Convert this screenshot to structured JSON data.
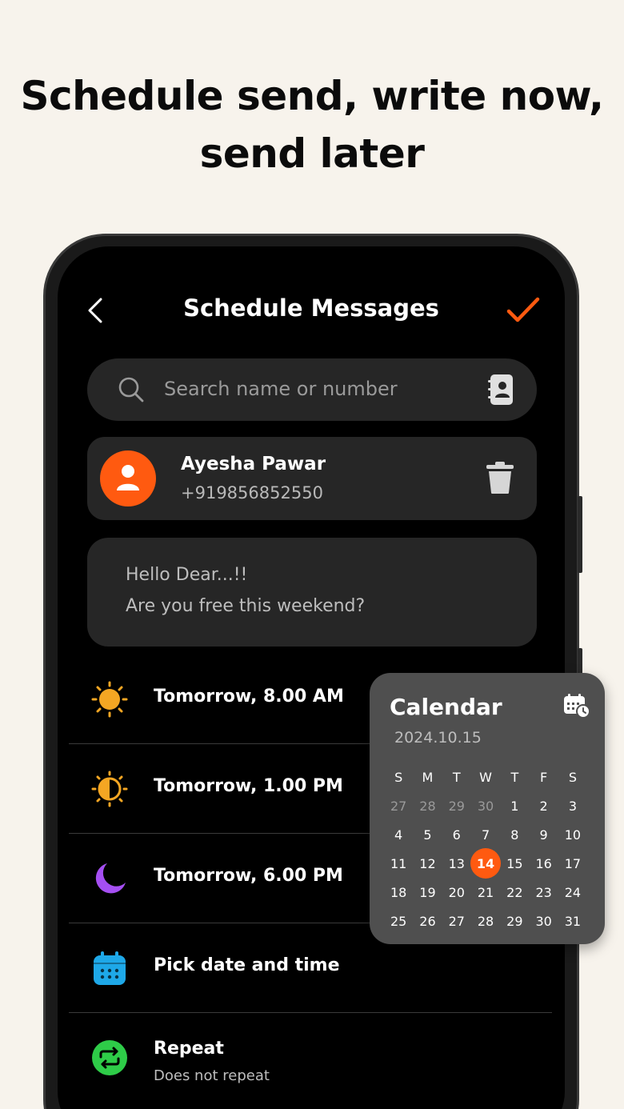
{
  "headline": {
    "line1": "Schedule send, write now,",
    "line2": "send later"
  },
  "header": {
    "title": "Schedule Messages",
    "back_icon": "chevron-left-icon",
    "confirm_icon": "check-icon",
    "accent": "#ff5a10"
  },
  "search": {
    "placeholder": "Search name or number"
  },
  "contact": {
    "name": "Ayesha Pawar",
    "number": "+919856852550"
  },
  "message": {
    "line1": "Hello Dear...!!",
    "line2": "Are you free this weekend?"
  },
  "options": [
    {
      "label": "Tomorrow, 8.00 AM",
      "icon": "sun-icon",
      "color": "#f4a623"
    },
    {
      "label": "Tomorrow, 1.00 PM",
      "icon": "half-sun-icon",
      "color": "#f4a623"
    },
    {
      "label": "Tomorrow, 6.00 PM",
      "icon": "moon-icon",
      "color": "#a54ff2"
    },
    {
      "label": "Pick date and time",
      "icon": "calendar-icon",
      "color": "#1ea8e8"
    },
    {
      "label": "Repeat",
      "sublabel": "Does not repeat",
      "icon": "repeat-icon",
      "color": "#2ecc48"
    }
  ],
  "calendar": {
    "title": "Calendar",
    "date": "2024.10.15",
    "weekdays": [
      "S",
      "M",
      "T",
      "W",
      "T",
      "F",
      "S"
    ],
    "weeks": [
      [
        "27",
        "28",
        "29",
        "30",
        "1",
        "2",
        "3"
      ],
      [
        "4",
        "5",
        "6",
        "7",
        "8",
        "9",
        "10"
      ],
      [
        "11",
        "12",
        "13",
        "14",
        "15",
        "16",
        "17"
      ],
      [
        "18",
        "19",
        "20",
        "21",
        "22",
        "23",
        "24"
      ],
      [
        "25",
        "26",
        "27",
        "28",
        "29",
        "30",
        "31"
      ]
    ],
    "muted_days": [
      "27",
      "28",
      "29",
      "30"
    ],
    "selected_day": "14"
  }
}
